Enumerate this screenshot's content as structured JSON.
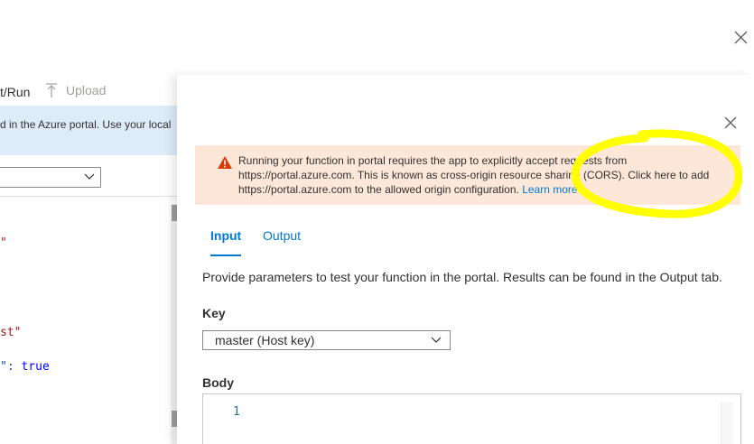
{
  "background": {
    "toolbar": {
      "test_run_label": "t/Run",
      "upload_label": "Upload"
    },
    "banner_text": "d in the Azure portal. Use your local",
    "code_lines": [
      {
        "text": "\"",
        "cls": "c-str"
      },
      {
        "text": "st\"",
        "cls": "c-str"
      },
      {
        "text": "\": true",
        "cls": "c-key"
      }
    ]
  },
  "panel": {
    "warning": {
      "line1": "Running your function in portal requires the app to explicitly accept requests from",
      "line2": "https://portal.azure.com. This is known as cross-origin resource sharing (CORS). Click here to add",
      "line3": "https://portal.azure.com to the allowed origin configuration.",
      "link": "Learn more"
    },
    "tabs": {
      "input": "Input",
      "output": "Output"
    },
    "description": "Provide parameters to test your function in the portal. Results can be found in the Output tab.",
    "key": {
      "label": "Key",
      "selected": "master (Host key)"
    },
    "body": {
      "label": "Body",
      "line_number": "1"
    }
  },
  "colors": {
    "accent": "#0078d4",
    "warning_bg": "#fde7d9",
    "warning_icon": "#d83b01",
    "highlight": "#ffff00",
    "info_bg": "#deecf9"
  },
  "icons": [
    "upload-icon",
    "warning-icon",
    "close-icon",
    "chevron-down-icon"
  ]
}
